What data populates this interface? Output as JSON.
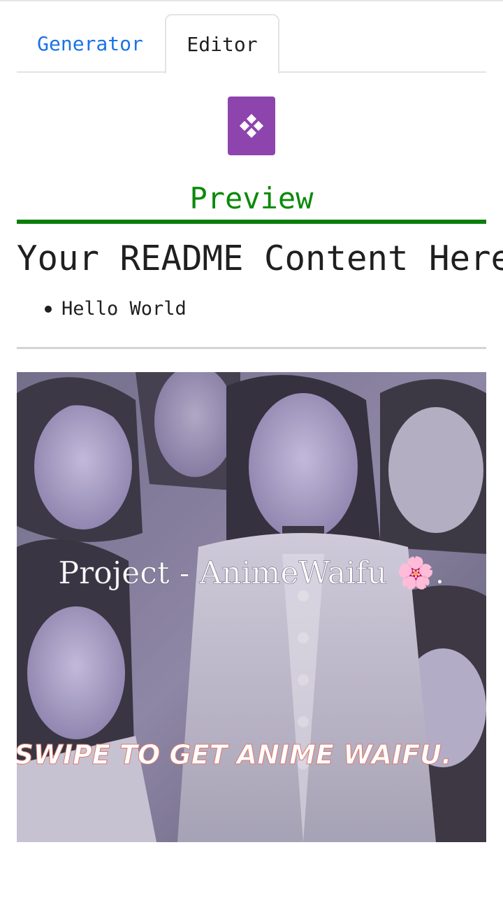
{
  "tabs": [
    {
      "label": "Generator",
      "active": false
    },
    {
      "label": "Editor",
      "active": true
    }
  ],
  "editor_button": {
    "icon": "diamond-grid-icon",
    "color": "#8e44ad"
  },
  "preview": {
    "heading": "Preview",
    "readme_title": "Your README Content Here",
    "list_items": [
      "Hello World"
    ],
    "banner": {
      "title": "Project - AnimeWaifu 🌸.",
      "tagline": "_SWIPE TO GET ANIME WAIFU."
    }
  }
}
